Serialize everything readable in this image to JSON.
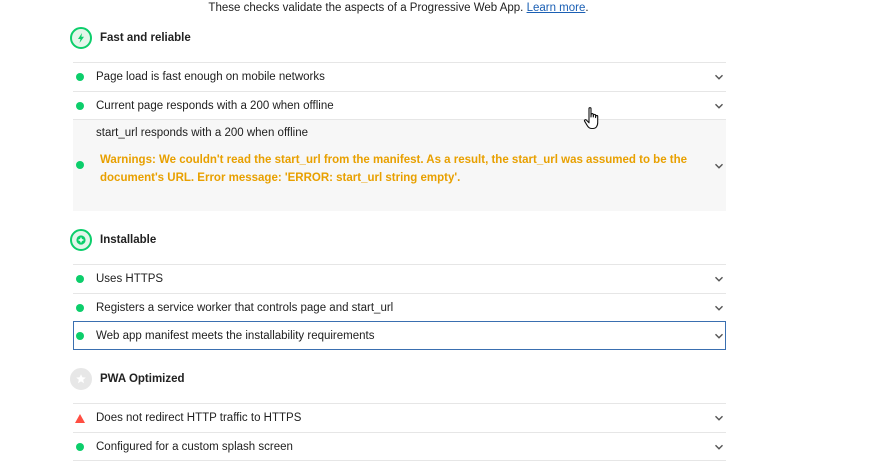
{
  "intro": {
    "text": "These checks validate the aspects of a Progressive Web App.",
    "link": "Learn more"
  },
  "colors": {
    "pass": "#0cce6b",
    "fail": "#ff4e42",
    "warning": "#e8a000",
    "link": "#1a5fb4"
  },
  "groups": [
    {
      "title": "Fast and reliable",
      "icon": "lightning-icon",
      "audits": [
        {
          "title": "Page load is fast enough on mobile networks",
          "status": "pass"
        },
        {
          "title": "Current page responds with a 200 when offline",
          "status": "pass"
        },
        {
          "title": "start_url responds with a 200 when offline",
          "status": "pass",
          "warning_label": "Warnings:",
          "warning": "We couldn't read the start_url from the manifest. As a result, the start_url was assumed to be the document's URL. Error message: 'ERROR: start_url string empty'."
        }
      ]
    },
    {
      "title": "Installable",
      "icon": "plus-icon",
      "audits": [
        {
          "title": "Uses HTTPS",
          "status": "pass"
        },
        {
          "title": "Registers a service worker that controls page and start_url",
          "status": "pass"
        },
        {
          "title": "Web app manifest meets the installability requirements",
          "status": "pass"
        }
      ]
    },
    {
      "title": "PWA Optimized",
      "icon": "star-icon",
      "audits": [
        {
          "title": "Does not redirect HTTP traffic to HTTPS",
          "status": "fail"
        },
        {
          "title": "Configured for a custom splash screen",
          "status": "pass"
        }
      ]
    }
  ]
}
